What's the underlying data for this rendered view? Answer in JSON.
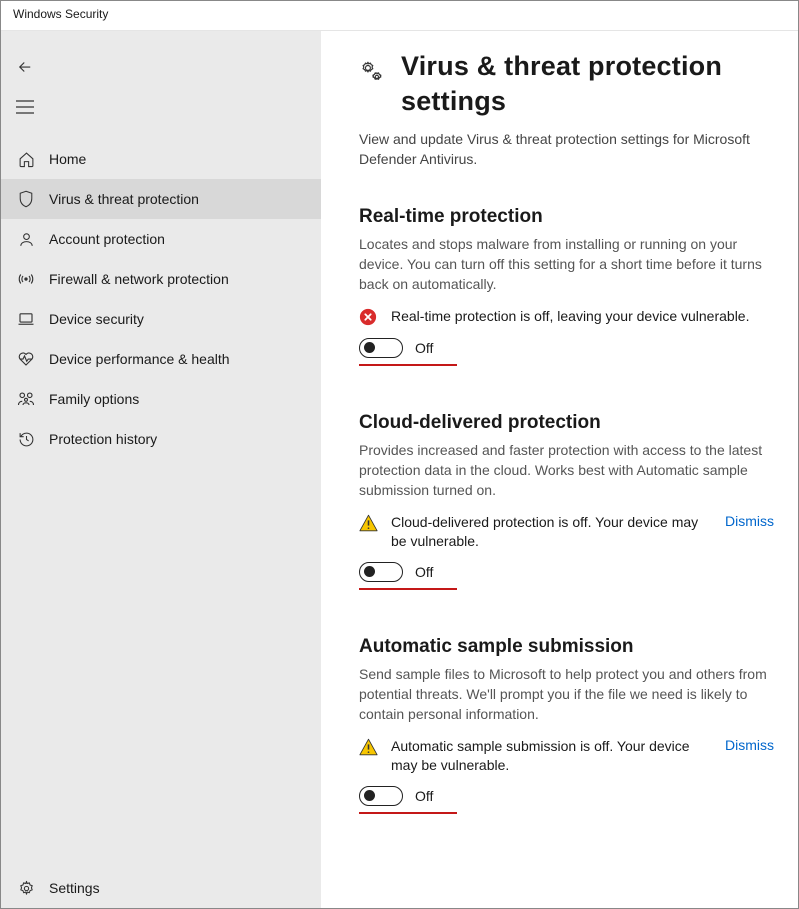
{
  "window_title": "Windows Security",
  "sidebar": {
    "items": [
      {
        "label": "Home"
      },
      {
        "label": "Virus & threat protection"
      },
      {
        "label": "Account protection"
      },
      {
        "label": "Firewall & network protection"
      },
      {
        "label": "Device security"
      },
      {
        "label": "Device performance & health"
      },
      {
        "label": "Family options"
      },
      {
        "label": "Protection history"
      }
    ],
    "settings_label": "Settings"
  },
  "page": {
    "title": "Virus & threat protection settings",
    "subtitle": "View and update Virus & threat protection settings for Microsoft Defender Antivirus."
  },
  "sections": {
    "realtime": {
      "title": "Real-time protection",
      "desc": "Locates and stops malware from installing or running on your device. You can turn off this setting for a short time before it turns back on automatically.",
      "alert": "Real-time protection is off, leaving your device vulnerable.",
      "toggle_state": "Off"
    },
    "cloud": {
      "title": "Cloud-delivered protection",
      "desc": "Provides increased and faster protection with access to the latest protection data in the cloud. Works best with Automatic sample submission turned on.",
      "alert": "Cloud-delivered protection is off. Your device may be vulnerable.",
      "dismiss": "Dismiss",
      "toggle_state": "Off"
    },
    "sample": {
      "title": "Automatic sample submission",
      "desc": "Send sample files to Microsoft to help protect you and others from potential threats. We'll prompt you if the file we need is likely to contain personal information.",
      "alert": "Automatic sample submission is off. Your device may be vulnerable.",
      "dismiss": "Dismiss",
      "toggle_state": "Off"
    }
  }
}
